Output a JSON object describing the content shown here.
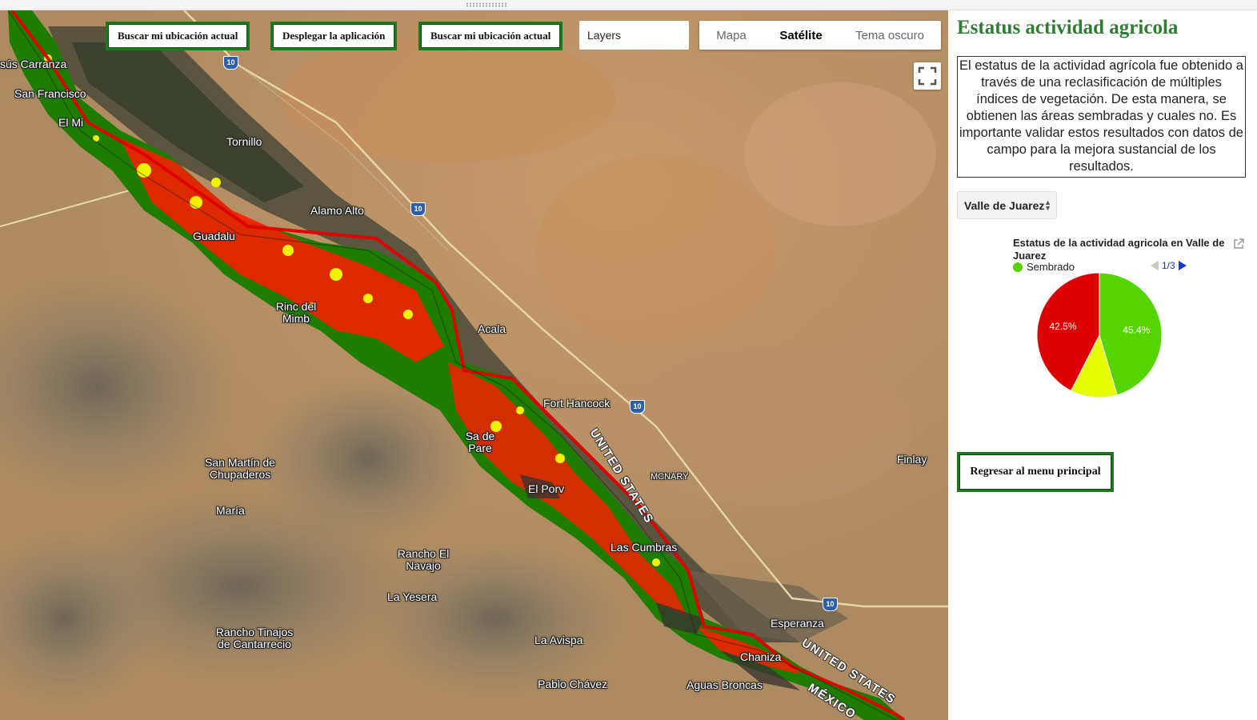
{
  "map": {
    "buttons": [
      {
        "label": "Buscar mi ubicación actual"
      },
      {
        "label": "Desplegar la aplicación"
      },
      {
        "label": "Buscar mi ubicación actual"
      }
    ],
    "layers_placeholder": "Layers",
    "map_types": [
      {
        "label": "Mapa",
        "active": false
      },
      {
        "label": "Satélite",
        "active": true
      },
      {
        "label": "Tema oscuro",
        "active": false
      }
    ],
    "places": [
      "sús Carranza",
      "San Francisco",
      "El Mi",
      "Tornillo",
      "Alamo Alto",
      "Guadalu",
      "Rinc del Mimb",
      "Acala",
      "Fort Hancock",
      "San Martín de Chupaderos",
      "María",
      "Rancho El Navajo",
      "La Yesera",
      "El Porv",
      "Las Cumbras",
      "Esperanza",
      "Rancho Tinajos de Cantarrecio",
      "La Avispa",
      "Pablo Chávez",
      "Aguas Broncas",
      "Chaniza",
      "Finlay",
      "MCNARY",
      "Sa de Pare"
    ],
    "border_labels": [
      "UNITED STATES",
      "UNITED STATES",
      "MÉXICO"
    ],
    "highway_shield": "10",
    "status_colors": {
      "sembrado": "#1a8a00",
      "no_sembrado": "#ff0000",
      "parcial": "#ffff00",
      "frontera": "#e00000"
    }
  },
  "panel": {
    "title": "Estatus actividad agricola",
    "description": "El estatus de la actividad agrícola fue obtenido a través de una reclasificación de múltiples índices de vegetación. De esta manera, se obtienen las áreas sembradas y cuales no. Es importante validar estos resultados con datos de campo para la mejora sustancial de los resultados.",
    "region_selected": "Valle de Juarez",
    "chart_title": "Estatus de la actividad agricola en Valle de Juarez",
    "legend_first": "Sembrado",
    "legend_page": "1/3",
    "back_button": "Regresar al menu principal"
  },
  "chart_data": {
    "type": "pie",
    "title": "Estatus de la actividad agricola en Valle de Juarez",
    "slices": [
      {
        "name": "Sembrado",
        "value": 45.4,
        "color": "#56d400",
        "label": "45.4%"
      },
      {
        "name": "",
        "value": 12.1,
        "color": "#e5ff00",
        "label": ""
      },
      {
        "name": "",
        "value": 42.5,
        "color": "#dc0000",
        "label": "42.5%"
      }
    ],
    "legend_position": "top",
    "legend_visible": [
      "Sembrado"
    ]
  }
}
